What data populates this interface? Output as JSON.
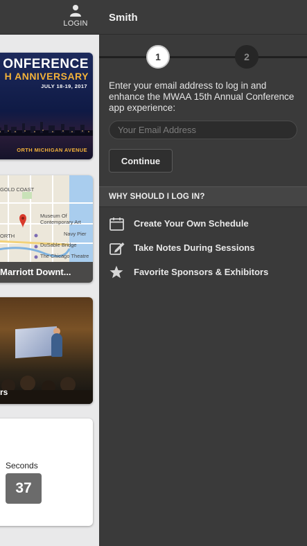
{
  "background": {
    "login_label": "LOGIN",
    "cards": {
      "conference": {
        "title": "ONFERENCE",
        "anniversary": "H ANNIVERSARY",
        "date": "JULY 18-19, 2017",
        "address": "ORTH MICHIGAN AVENUE"
      },
      "map": {
        "labels": [
          "GOLD COAST",
          "Museum Of",
          "Contemporary Art",
          "Navy Pier",
          "DuSable Bridge",
          "ORTH",
          "The Chicago Theatre"
        ],
        "caption": "Marriott Downt..."
      },
      "photo": {
        "caption": "rs"
      },
      "countdown": {
        "label": "Seconds",
        "value": "37"
      }
    }
  },
  "panel": {
    "title": "Smith",
    "steps": [
      "1",
      "2"
    ],
    "active_step": 1,
    "intro": "Enter your email address to log in and enhance the MWAA 15th Annual Conference app experience:",
    "email_placeholder": "Your Email Address",
    "continue_label": "Continue",
    "why_heading": "WHY SHOULD I LOG IN?",
    "benefits": [
      {
        "icon": "calendar-icon",
        "text": "Create Your Own Schedule"
      },
      {
        "icon": "edit-note-icon",
        "text": "Take Notes During Sessions"
      },
      {
        "icon": "star-icon",
        "text": "Favorite Sponsors & Exhibitors"
      }
    ]
  },
  "colors": {
    "panel_bg": "#3a3a3a",
    "conference_gold": "#f3b23a",
    "map_pin": "#d93a2b"
  }
}
